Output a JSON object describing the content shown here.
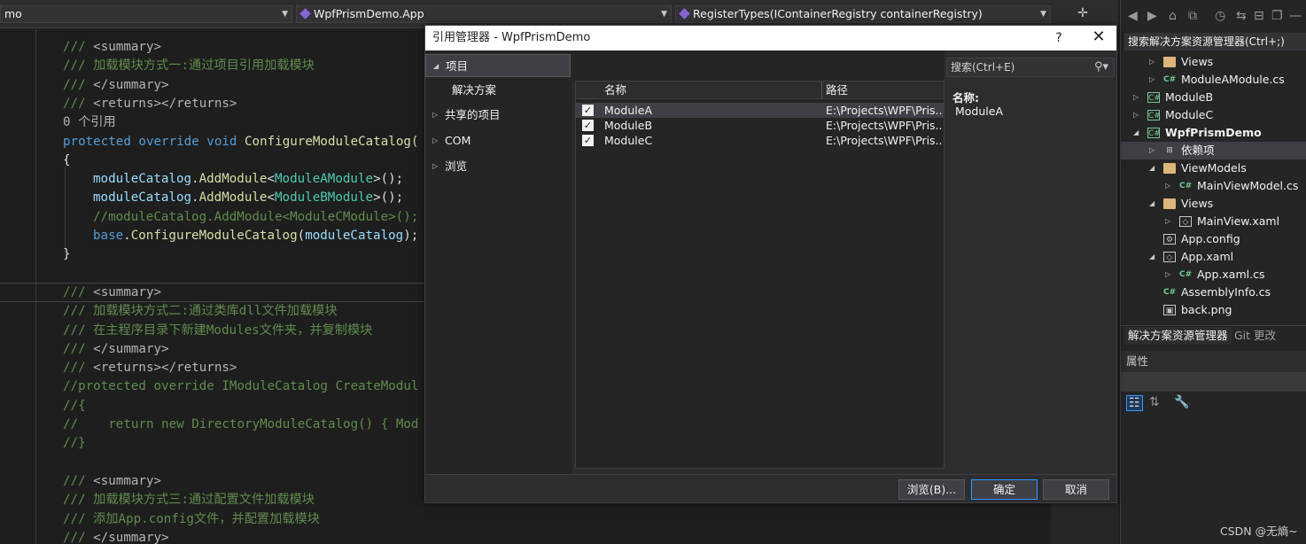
{
  "navbar": {
    "project_combo": "mo",
    "class_combo": "WpfPrismDemo.App",
    "member_combo": "RegisterTypes(IContainerRegistry containerRegistry)"
  },
  "editor": {
    "lines": [
      {
        "segments": [
          {
            "t": "/// ",
            "c": "c-xml"
          },
          {
            "t": "<summary>",
            "c": "c-gray"
          }
        ]
      },
      {
        "segments": [
          {
            "t": "/// 加载模块方式一:通过项目引用加载模块",
            "c": "c-xml"
          }
        ]
      },
      {
        "segments": [
          {
            "t": "/// ",
            "c": "c-xml"
          },
          {
            "t": "</summary>",
            "c": "c-gray"
          }
        ]
      },
      {
        "segments": [
          {
            "t": "/// ",
            "c": "c-xml"
          },
          {
            "t": "<returns></returns>",
            "c": "c-gray"
          }
        ]
      },
      {
        "segments": [
          {
            "t": "0 个引用",
            "c": "c-gray"
          }
        ]
      },
      {
        "segments": [
          {
            "t": "protected ",
            "c": "c-kw"
          },
          {
            "t": "override ",
            "c": "c-kw"
          },
          {
            "t": "void ",
            "c": "c-kw"
          },
          {
            "t": "ConfigureModuleCatalog(",
            "c": "c-fn"
          }
        ]
      },
      {
        "segments": [
          {
            "t": "{",
            "c": "c-pl"
          }
        ]
      },
      {
        "indent": true,
        "segments": [
          {
            "t": "moduleCatalog",
            "c": "c-id"
          },
          {
            "t": ".",
            "c": "c-pl"
          },
          {
            "t": "AddModule",
            "c": "c-fn"
          },
          {
            "t": "<",
            "c": "c-pl"
          },
          {
            "t": "ModuleAModule",
            "c": "c-type"
          },
          {
            "t": ">();",
            "c": "c-pl"
          }
        ]
      },
      {
        "indent": true,
        "segments": [
          {
            "t": "moduleCatalog",
            "c": "c-id"
          },
          {
            "t": ".",
            "c": "c-pl"
          },
          {
            "t": "AddModule",
            "c": "c-fn"
          },
          {
            "t": "<",
            "c": "c-pl"
          },
          {
            "t": "ModuleBModule",
            "c": "c-type"
          },
          {
            "t": ">();",
            "c": "c-pl"
          }
        ]
      },
      {
        "indent": true,
        "segments": [
          {
            "t": "//moduleCatalog.AddModule<ModuleCModule>();",
            "c": "c-xml"
          }
        ]
      },
      {
        "indent": true,
        "segments": [
          {
            "t": "base",
            "c": "c-kw"
          },
          {
            "t": ".",
            "c": "c-pl"
          },
          {
            "t": "ConfigureModuleCatalog",
            "c": "c-fn"
          },
          {
            "t": "(",
            "c": "c-pl"
          },
          {
            "t": "moduleCatalog",
            "c": "c-id"
          },
          {
            "t": ");",
            "c": "c-pl"
          }
        ]
      },
      {
        "segments": [
          {
            "t": "}",
            "c": "c-pl"
          }
        ]
      },
      {
        "segments": []
      },
      {
        "segments": [
          {
            "t": "/// ",
            "c": "c-xml"
          },
          {
            "t": "<summary>",
            "c": "c-gray"
          }
        ]
      },
      {
        "segments": [
          {
            "t": "/// 加载模块方式二:通过类库dll文件加载模块",
            "c": "c-xml"
          }
        ]
      },
      {
        "segments": [
          {
            "t": "/// 在主程序目录下新建Modules文件夹，并复制模块",
            "c": "c-xml"
          }
        ]
      },
      {
        "segments": [
          {
            "t": "/// ",
            "c": "c-xml"
          },
          {
            "t": "</summary>",
            "c": "c-gray"
          }
        ]
      },
      {
        "segments": [
          {
            "t": "/// ",
            "c": "c-xml"
          },
          {
            "t": "<returns></returns>",
            "c": "c-gray"
          }
        ]
      },
      {
        "segments": [
          {
            "t": "//protected override IModuleCatalog CreateModul",
            "c": "c-xml"
          }
        ]
      },
      {
        "segments": [
          {
            "t": "//{",
            "c": "c-xml"
          }
        ]
      },
      {
        "segments": [
          {
            "t": "//    return new DirectoryModuleCatalog() { Mod",
            "c": "c-xml"
          }
        ]
      },
      {
        "segments": [
          {
            "t": "//}",
            "c": "c-xml"
          }
        ]
      },
      {
        "segments": []
      },
      {
        "segments": [
          {
            "t": "/// ",
            "c": "c-xml"
          },
          {
            "t": "<summary>",
            "c": "c-gray"
          }
        ]
      },
      {
        "segments": [
          {
            "t": "/// 加载模块方式三:通过配置文件加载模块",
            "c": "c-xml"
          }
        ]
      },
      {
        "segments": [
          {
            "t": "/// 添加App.config文件，并配置加载模块",
            "c": "c-xml"
          }
        ]
      },
      {
        "segments": [
          {
            "t": "/// ",
            "c": "c-xml"
          },
          {
            "t": "</summary>",
            "c": "c-gray"
          }
        ]
      }
    ]
  },
  "solution_explorer": {
    "search_placeholder": "搜索解决方案资源管理器(Ctrl+;)",
    "items": [
      {
        "label": "Views",
        "icon": "folder-icon",
        "depth": 2,
        "arrow": "▷"
      },
      {
        "label": "ModuleAModule.cs",
        "icon": "csharp-file-icon",
        "depth": 2,
        "arrow": "▷"
      },
      {
        "label": "ModuleB",
        "icon": "csharp-project-icon",
        "depth": 1,
        "arrow": "▷"
      },
      {
        "label": "ModuleC",
        "icon": "csharp-project-icon",
        "depth": 1,
        "arrow": "▷"
      },
      {
        "label": "WpfPrismDemo",
        "icon": "csharp-project-icon",
        "depth": 1,
        "arrow": "◢",
        "bold": true
      },
      {
        "label": "依赖项",
        "icon": "dependencies-icon",
        "depth": 2,
        "arrow": "▷",
        "selected": true
      },
      {
        "label": "ViewModels",
        "icon": "folder-icon",
        "depth": 2,
        "arrow": "◢"
      },
      {
        "label": "MainViewModel.cs",
        "icon": "csharp-file-icon",
        "depth": 3,
        "arrow": "▷"
      },
      {
        "label": "Views",
        "icon": "folder-icon",
        "depth": 2,
        "arrow": "◢"
      },
      {
        "label": "MainView.xaml",
        "icon": "xaml-file-icon",
        "depth": 3,
        "arrow": "▷"
      },
      {
        "label": "App.config",
        "icon": "config-file-icon",
        "depth": 2,
        "arrow": ""
      },
      {
        "label": "App.xaml",
        "icon": "xaml-file-icon",
        "depth": 2,
        "arrow": "◢"
      },
      {
        "label": "App.xaml.cs",
        "icon": "csharp-file-icon",
        "depth": 3,
        "arrow": "▷"
      },
      {
        "label": "AssemblyInfo.cs",
        "icon": "csharp-file-icon",
        "depth": 2,
        "arrow": ""
      },
      {
        "label": "back.png",
        "icon": "image-file-icon",
        "depth": 2,
        "arrow": ""
      }
    ],
    "tabs": [
      "解决方案资源管理器",
      "Git 更改"
    ],
    "properties_title": "属性"
  },
  "dialog": {
    "title": "引用管理器 - WpfPrismDemo",
    "help": "?",
    "close": "✕",
    "nav": [
      {
        "label": "项目",
        "arrow": "◢",
        "selected": true
      },
      {
        "label": "解决方案",
        "arrow": "",
        "sub": true
      },
      {
        "label": "共享的项目",
        "arrow": "▷"
      },
      {
        "label": "COM",
        "arrow": "▷"
      },
      {
        "label": "浏览",
        "arrow": "▷"
      }
    ],
    "columns": {
      "name": "名称",
      "path": "路径"
    },
    "rows": [
      {
        "checked": true,
        "name": "ModuleA",
        "path": "E:\\Projects\\WPF\\Pris...",
        "selected": true
      },
      {
        "checked": true,
        "name": "ModuleB",
        "path": "E:\\Projects\\WPF\\Pris..."
      },
      {
        "checked": true,
        "name": "ModuleC",
        "path": "E:\\Projects\\WPF\\Pris..."
      }
    ],
    "search_placeholder": "搜索(Ctrl+E)",
    "detail_label": "名称:",
    "detail_value": "ModuleA",
    "buttons": {
      "browse": "浏览(B)...",
      "ok": "确定",
      "cancel": "取消"
    }
  },
  "watermark": "CSDN @无熵~"
}
